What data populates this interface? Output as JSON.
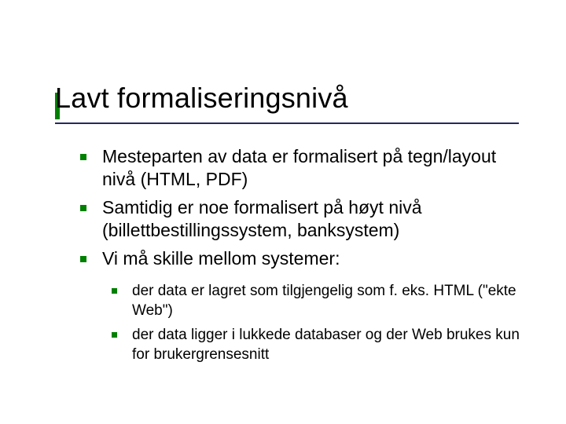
{
  "slide": {
    "title": "Lavt formaliseringsnivå",
    "bullets": [
      {
        "text": "Mesteparten av data er formalisert på tegn/layout nivå (HTML, PDF)"
      },
      {
        "text": "Samtidig er noe formalisert på høyt nivå (billettbestillingssystem, banksystem)"
      },
      {
        "text": "Vi må skille mellom systemer:"
      }
    ],
    "subbullets": [
      {
        "text": "der data er lagret som tilgjengelig som f. eks. HTML (\"ekte Web\")"
      },
      {
        "text": "der data ligger i lukkede databaser og der Web brukes kun for brukergrensesnitt"
      }
    ],
    "colors": {
      "accent": "#008000",
      "underline": "#27285f"
    }
  }
}
